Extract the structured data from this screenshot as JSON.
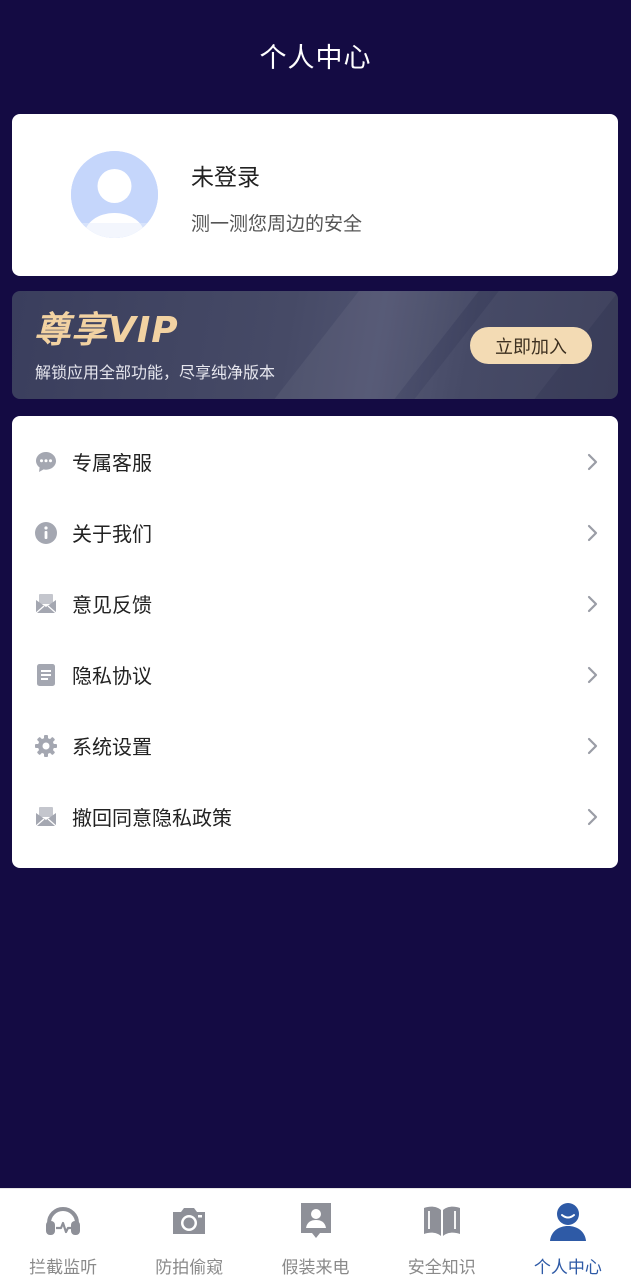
{
  "header": {
    "title": "个人中心"
  },
  "profile": {
    "name": "未登录",
    "subtitle": "测一测您周边的安全"
  },
  "vip": {
    "title": "尊享VIP",
    "subtitle": "解锁应用全部功能，尽享纯净版本",
    "join_label": "立即加入"
  },
  "menu": {
    "items": [
      {
        "label": "专属客服",
        "icon": "chat-bubble-icon"
      },
      {
        "label": "关于我们",
        "icon": "info-icon"
      },
      {
        "label": "意见反馈",
        "icon": "mail-icon"
      },
      {
        "label": "隐私协议",
        "icon": "document-icon"
      },
      {
        "label": "系统设置",
        "icon": "gear-icon"
      },
      {
        "label": "撤回同意隐私政策",
        "icon": "mail-icon"
      }
    ]
  },
  "tabbar": {
    "items": [
      {
        "label": "拦截监听",
        "icon": "headset-icon"
      },
      {
        "label": "防拍偷窥",
        "icon": "camera-icon"
      },
      {
        "label": "假装来电",
        "icon": "contact-card-icon"
      },
      {
        "label": "安全知识",
        "icon": "book-icon"
      },
      {
        "label": "个人中心",
        "icon": "person-icon"
      }
    ],
    "active_index": 4
  },
  "colors": {
    "background": "#140b43",
    "vip_gold": "#f2d2a2",
    "join_button": "#f3dbb4",
    "active_tab": "#2e5aa6",
    "icon_gray": "#a4a7b1"
  }
}
